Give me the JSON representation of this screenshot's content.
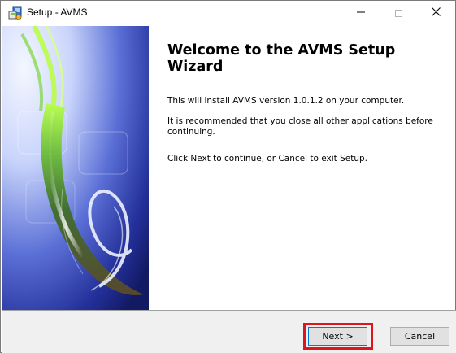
{
  "window": {
    "title": "Setup - AVMS"
  },
  "content": {
    "heading": "Welcome to the AVMS Setup Wizard",
    "paragraph_1": "This will install AVMS version 1.0.1.2 on your computer.",
    "paragraph_2": "It is recommended that you close all other applications before continuing.",
    "paragraph_3": "Click Next to continue, or Cancel to exit Setup."
  },
  "buttons": {
    "next_label": "Next >",
    "cancel_label": "Cancel"
  },
  "icons": {
    "app": "setup-installer-icon",
    "minimize": "minimize-icon",
    "maximize": "maximize-icon",
    "close": "close-icon"
  },
  "colors": {
    "banner_dark_blue": "#14206e",
    "banner_mid_blue": "#4b5fd0",
    "banner_light": "#eef2ff",
    "accent_green": "#9ee63c",
    "highlight_red": "#e0141e",
    "footer_bg": "#f0f0f0"
  }
}
